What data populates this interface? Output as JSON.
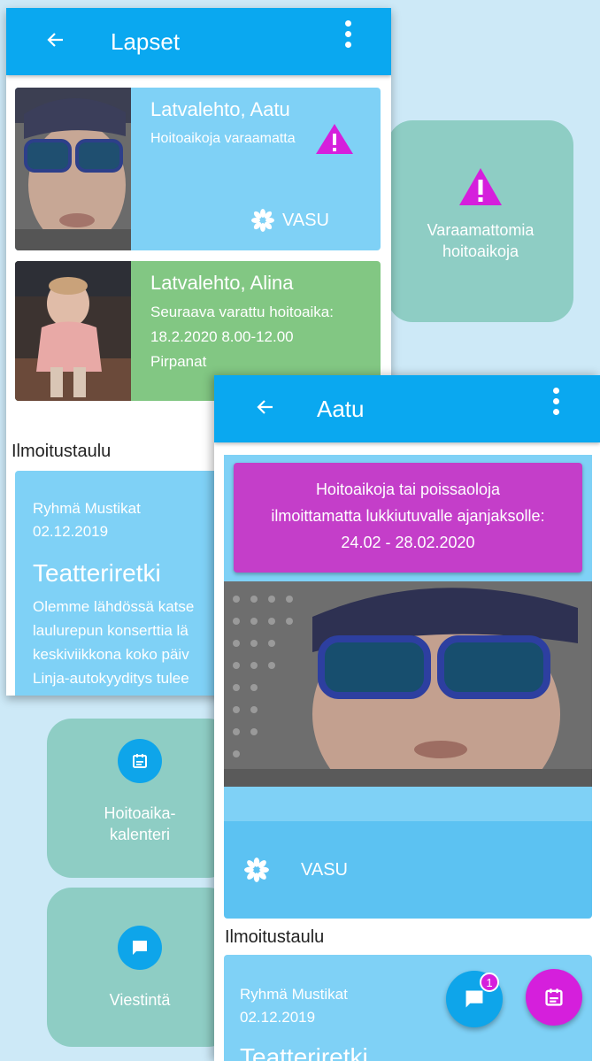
{
  "screen1": {
    "title": "Lapset",
    "children": [
      {
        "name": "Latvalehto, Aatu",
        "status": "Hoitoaikoja varaamatta",
        "vasu_label": "VASU"
      },
      {
        "name": "Latvalehto, Alina",
        "lines": [
          "Seuraava varattu hoitoaika:",
          "18.2.2020 8.00-12.00",
          "Pirpanat"
        ]
      }
    ],
    "board_title": "Ilmoitustaulu",
    "notice": {
      "group": "Ryhmä Mustikat",
      "date": "02.12.2019",
      "title": "Teatteriretki",
      "body": [
        "Olemme lähdössä katse",
        "laulurepun konserttia lä",
        "keskiviikkona koko päiv",
        "Linja-autokyyditys tulee"
      ]
    }
  },
  "tiles": {
    "warning_line1": "Varaamattomia",
    "warning_line2": "hoitoaikoja",
    "calendar_line1": "Hoitoaika-",
    "calendar_line2": "kalenteri",
    "messages": "Viestintä"
  },
  "screen2": {
    "title": "Aatu",
    "alert_line1": "Hoitoaikoja tai poissaoloja",
    "alert_line2": "ilmoittamatta lukkiutuvalle ajanjaksolle:",
    "alert_line3": "24.02 - 28.02.2020",
    "vasu_label": "VASU",
    "board_title": "Ilmoitustaulu",
    "notice": {
      "group": "Ryhmä Mustikat",
      "date": "02.12.2019",
      "title": "Teatteriretki"
    },
    "message_badge": "1"
  },
  "colors": {
    "primary": "#0aa8f0",
    "card_blue": "#7fd1f6",
    "card_green": "#82c783",
    "alert_magenta": "#c43ec9",
    "tile_teal": "#8ecdc4",
    "warning_magenta": "#d51fdc"
  }
}
